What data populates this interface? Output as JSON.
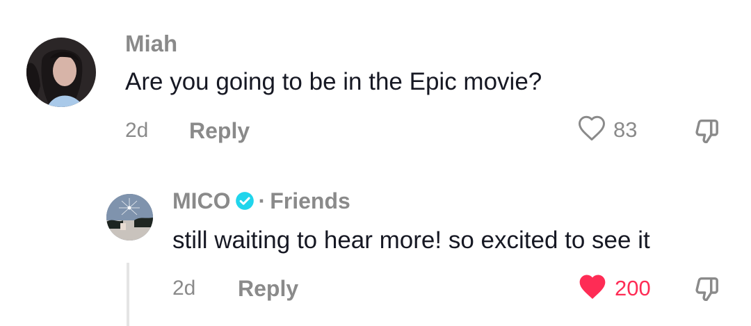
{
  "comment": {
    "username": "Miah",
    "text": "Are you going to be in the Epic movie?",
    "time": "2d",
    "reply_label": "Reply",
    "likes": "83",
    "liked": false,
    "icons": {
      "like": "heart-outline-icon",
      "dislike": "thumbs-down-icon"
    }
  },
  "reply": {
    "username": "MICO",
    "verified": true,
    "separator": "·",
    "relation": "Friends",
    "text": "still waiting to hear more! so excited to see it",
    "time": "2d",
    "reply_label": "Reply",
    "likes": "200",
    "liked": true,
    "icons": {
      "like": "heart-filled-icon",
      "dislike": "thumbs-down-icon",
      "badge": "verified-badge-icon"
    }
  },
  "colors": {
    "accent_like": "#fe2c55",
    "verified": "#20d5ec",
    "muted_text": "#8a8a8a",
    "primary_text": "#161823"
  }
}
